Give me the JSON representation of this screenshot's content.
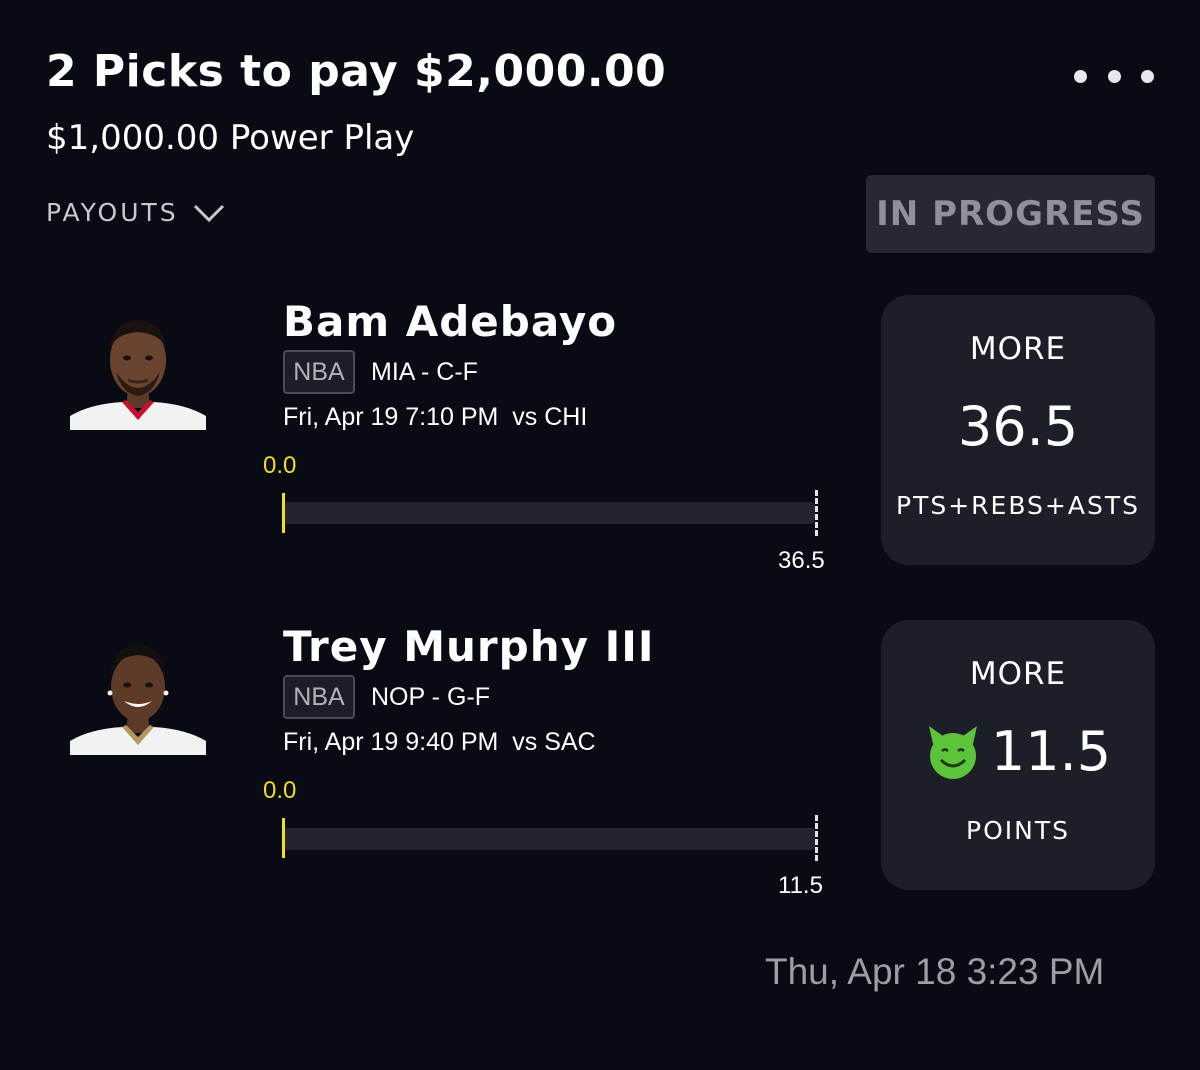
{
  "header": {
    "title": "2 Picks to pay $2,000.00",
    "subtitle": "$1,000.00 Power Play",
    "menu_icon": "more-horizontal-icon"
  },
  "payouts": {
    "label": "PAYOUTS",
    "icon": "chevron-down-icon"
  },
  "status": {
    "label": "IN PROGRESS"
  },
  "picks": [
    {
      "player_name": "Bam Adebayo",
      "league": "NBA",
      "team_position": "MIA - C-F",
      "game_time": "Fri, Apr 19 7:10 PM  vs CHI",
      "current_value": "0.0",
      "target_value": "36.5",
      "progress_fraction": 0,
      "direction": "MORE",
      "line": "36.5",
      "stat": "PTS+REBS+ASTS",
      "badge_icon": null,
      "avatar_icon": "player-headshot-icon",
      "jersey_trim_color": "#c8102e"
    },
    {
      "player_name": "Trey Murphy III",
      "league": "NBA",
      "team_position": "NOP - G-F",
      "game_time": "Fri, Apr 19 9:40 PM  vs SAC",
      "current_value": "0.0",
      "target_value": "11.5",
      "progress_fraction": 0,
      "direction": "MORE",
      "line": "11.5",
      "stat": "POINTS",
      "badge_icon": "demon-icon",
      "avatar_icon": "player-headshot-icon",
      "jersey_trim_color": "#b4975a"
    }
  ],
  "footer": {
    "timestamp": "Thu, Apr 18 3:23 PM"
  },
  "colors": {
    "background": "#080a14",
    "card": "#1c1e28",
    "progress_accent": "#f4dd1a",
    "status_badge": "#262833",
    "demon_green": "#5cc43a"
  }
}
